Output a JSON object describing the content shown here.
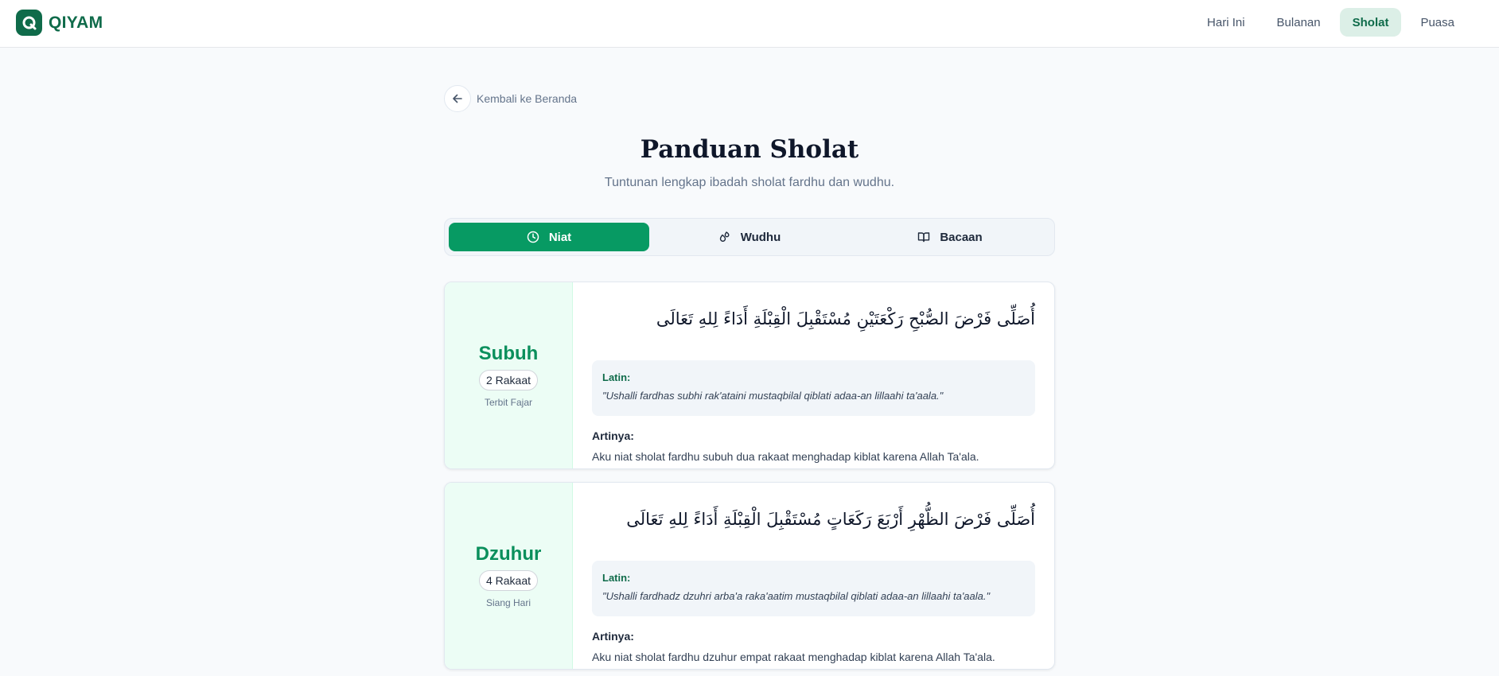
{
  "app": {
    "name": "QIYAM"
  },
  "nav": {
    "items": [
      {
        "label": "Hari Ini"
      },
      {
        "label": "Bulanan"
      },
      {
        "label": "Sholat"
      },
      {
        "label": "Puasa"
      }
    ],
    "active": "Sholat"
  },
  "back": {
    "label": "Kembali ke Beranda"
  },
  "page": {
    "title": "Panduan Sholat",
    "subtitle": "Tuntunan lengkap ibadah sholat fardhu dan wudhu."
  },
  "tabs": [
    {
      "label": "Niat",
      "icon": "clock-icon",
      "active": true
    },
    {
      "label": "Wudhu",
      "icon": "droplets-icon",
      "active": false
    },
    {
      "label": "Bacaan",
      "icon": "book-open-icon",
      "active": false
    }
  ],
  "prayers": [
    {
      "name": "Subuh",
      "rakaat": "2 Rakaat",
      "time": "Terbit Fajar",
      "arabic": "أُصَلِّى فَرْضَ الصُّبْحِ رَكْعَتَيْنِ مُسْتَقْبِلَ الْقِبْلَةِ أَدَاءً لِلهِ تَعَالَى",
      "latin_label": "Latin:",
      "latin": "\"Ushalli fardhas subhi rak'ataini mustaqbilal qiblati adaa-an lillaahi ta'aala.\"",
      "meaning_label": "Artinya:",
      "meaning": "Aku niat sholat fardhu subuh dua rakaat menghadap kiblat karena Allah Ta'ala."
    },
    {
      "name": "Dzuhur",
      "rakaat": "4 Rakaat",
      "time": "Siang Hari",
      "arabic": "أُصَلِّى فَرْضَ الظُّهْرِ أَرْبَعَ رَكَعَاتٍ مُسْتَقْبِلَ الْقِبْلَةِ أَدَاءً لِلهِ تَعَالَى",
      "latin_label": "Latin:",
      "latin": "\"Ushalli fardhadz dzuhri arba'a raka'aatim mustaqbilal qiblati adaa-an lillaahi ta'aala.\"",
      "meaning_label": "Artinya:",
      "meaning": "Aku niat sholat fardhu dzuhur empat rakaat menghadap kiblat karena Allah Ta'ala."
    }
  ],
  "colors": {
    "brand": "#0f6b4a",
    "accent": "#079a63",
    "prayer_name": "#0a8f5c",
    "card_side": "#ecfdf5"
  }
}
